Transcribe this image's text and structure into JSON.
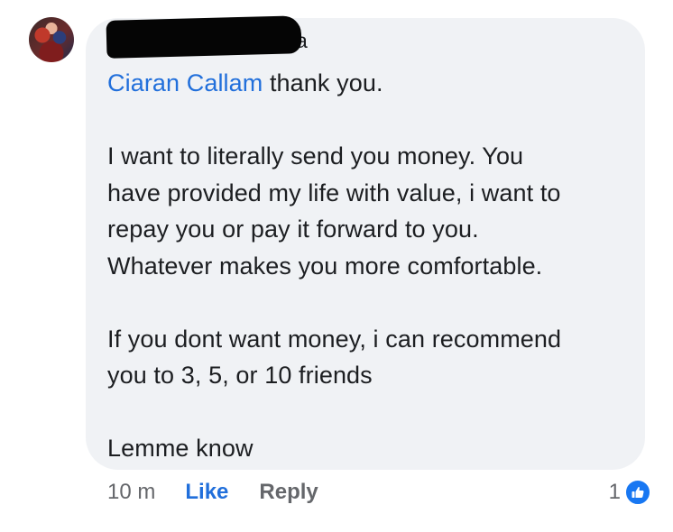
{
  "comment": {
    "author_visible_fragment": "a",
    "mention": "Ciaran Callam",
    "first_line_rest": " thank you.",
    "paragraphs": [
      "I want to literally send you money. You",
      "have provided my life with value, i want to",
      "repay you or pay it forward to you.",
      "Whatever makes you more comfortable."
    ],
    "paragraph2": [
      "If you dont want money, i can recommend",
      "you to 3, 5, or 10 friends"
    ],
    "closing": "Lemme know"
  },
  "meta": {
    "time": "10 m",
    "like_label": "Like",
    "reply_label": "Reply"
  },
  "reactions": {
    "count": "1",
    "icon": "thumbs-up-icon",
    "badge_color": "#1877f2"
  },
  "colors": {
    "mention": "#216fdb",
    "bubble": "#f0f2f5",
    "muted": "#65676b"
  }
}
